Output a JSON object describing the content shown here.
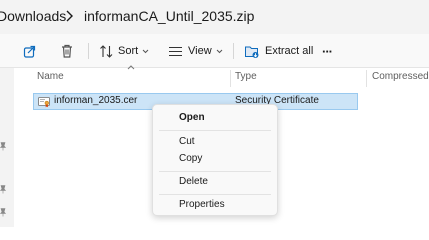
{
  "address_bar": {
    "root_crumb": "Downloads",
    "current_crumb": "informanCA_Until_2035.zip"
  },
  "toolbar": {
    "share_icon": "share-icon",
    "delete_icon": "trash-icon",
    "sort_label": "Sort",
    "view_label": "View",
    "extract_label": "Extract all",
    "more_label": "···"
  },
  "columns": {
    "name": "Name",
    "type": "Type",
    "compressed": "Compressed s"
  },
  "file": {
    "name": "informan_2035.cer",
    "type": "Security Certificate"
  },
  "context_menu": {
    "open": "Open",
    "cut": "Cut",
    "copy": "Copy",
    "delete": "Delete",
    "properties": "Properties"
  },
  "colors": {
    "selection_bg": "#cce4f7",
    "selection_border": "#99c9ef",
    "icon_blue": "#0f6cbd"
  }
}
